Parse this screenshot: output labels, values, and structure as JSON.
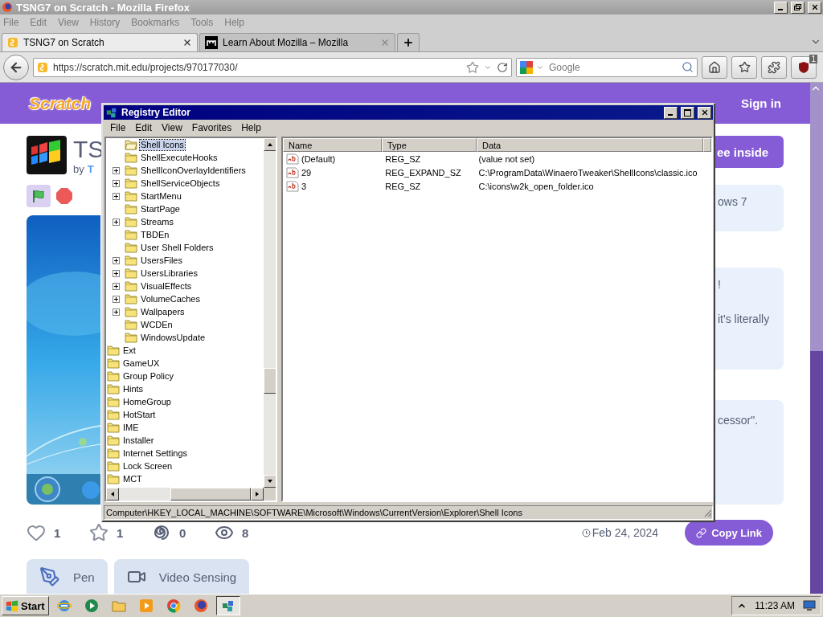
{
  "browser": {
    "title": "TSNG7 on Scratch - Mozilla Firefox",
    "menu": [
      "File",
      "Edit",
      "View",
      "History",
      "Bookmarks",
      "Tools",
      "Help"
    ],
    "tabs": [
      {
        "kind": "scratch",
        "label": "TSNG7 on Scratch",
        "selected": true
      },
      {
        "kind": "mozilla",
        "label": "Learn About Mozilla – Mozilla",
        "selected": false
      }
    ],
    "url": "https://scratch.mit.edu/projects/970177030/",
    "search": {
      "placeholder": "Google"
    },
    "addon_badge": "1"
  },
  "page": {
    "logo": "Scratch",
    "sign_in": "Sign in",
    "title": "TS",
    "byline": "by",
    "author": "T",
    "see_inside": "ee inside",
    "cards": [
      {
        "lines": [
          "ows 7"
        ]
      },
      {
        "lines": [
          "!",
          "it's literally"
        ]
      },
      {
        "lines": [
          "cessor\"."
        ]
      }
    ],
    "stats": [
      {
        "kind": "love",
        "count": "1"
      },
      {
        "kind": "favorite",
        "count": "1"
      },
      {
        "kind": "remix",
        "count": "0"
      },
      {
        "kind": "view",
        "count": "8"
      }
    ],
    "date": "Feb 24, 2024",
    "copy_link": "Copy Link",
    "extensions": [
      {
        "kind": "pen",
        "label": "Pen"
      },
      {
        "kind": "video",
        "label": "Video Sensing"
      }
    ]
  },
  "regedit": {
    "title": "Registry Editor",
    "menu": [
      "File",
      "Edit",
      "View",
      "Favorites",
      "Help"
    ],
    "tree": [
      {
        "children": [
          {
            "label": "Shell Icons",
            "selected": true,
            "expandable": false
          },
          {
            "label": "ShellExecuteHooks",
            "selected": false,
            "expandable": false
          },
          {
            "label": "ShellIconOverlayIdentifiers",
            "selected": false,
            "expandable": true
          },
          {
            "label": "ShellServiceObjects",
            "selected": false,
            "expandable": true
          },
          {
            "label": "StartMenu",
            "selected": false,
            "expandable": true
          },
          {
            "label": "StartPage",
            "selected": false,
            "expandable": false
          },
          {
            "label": "Streams",
            "selected": false,
            "expandable": true
          },
          {
            "label": "TBDEn",
            "selected": false,
            "expandable": false
          },
          {
            "label": "User Shell Folders",
            "selected": false,
            "expandable": false
          },
          {
            "label": "UsersFiles",
            "selected": false,
            "expandable": true
          },
          {
            "label": "UsersLibraries",
            "selected": false,
            "expandable": true
          },
          {
            "label": "VisualEffects",
            "selected": false,
            "expandable": true
          },
          {
            "label": "VolumeCaches",
            "selected": false,
            "expandable": true
          },
          {
            "label": "Wallpapers",
            "selected": false,
            "expandable": true
          },
          {
            "label": "WCDEn",
            "selected": false,
            "expandable": false
          },
          {
            "label": "WindowsUpdate",
            "selected": false,
            "expandable": false
          }
        ]
      },
      {
        "label": "Ext",
        "selected": false
      },
      {
        "label": "GameUX",
        "selected": false
      },
      {
        "label": "Group Policy",
        "selected": false
      },
      {
        "label": "Hints",
        "selected": false
      },
      {
        "label": "HomeGroup",
        "selected": false
      },
      {
        "label": "HotStart",
        "selected": false
      },
      {
        "label": "IME",
        "selected": false
      },
      {
        "label": "Installer",
        "selected": false
      },
      {
        "label": "Internet Settings",
        "selected": false
      },
      {
        "label": "Lock Screen",
        "selected": false
      },
      {
        "label": "MCT",
        "selected": false
      }
    ],
    "columns": [
      "Name",
      "Type",
      "Data"
    ],
    "values": [
      {
        "name": "(Default)",
        "type": "REG_SZ",
        "data": "(value not set)"
      },
      {
        "name": "29",
        "type": "REG_EXPAND_SZ",
        "data": "C:\\ProgramData\\WinaeroTweaker\\ShellIcons\\classic.ico"
      },
      {
        "name": "3",
        "type": "REG_SZ",
        "data": "C:\\icons\\w2k_open_folder.ico"
      }
    ],
    "status": "Computer\\HKEY_LOCAL_MACHINE\\SOFTWARE\\Microsoft\\Windows\\CurrentVersion\\Explorer\\Shell Icons"
  },
  "taskbar": {
    "start": "Start",
    "apps": [
      {
        "kind": "ie",
        "active": false
      },
      {
        "kind": "media-center",
        "active": false
      },
      {
        "kind": "explorer",
        "active": false
      },
      {
        "kind": "media-player",
        "active": false
      },
      {
        "kind": "chrome",
        "active": false
      },
      {
        "kind": "firefox",
        "active": false
      },
      {
        "kind": "regedit",
        "active": true
      }
    ],
    "clock": "11:23 AM"
  }
}
